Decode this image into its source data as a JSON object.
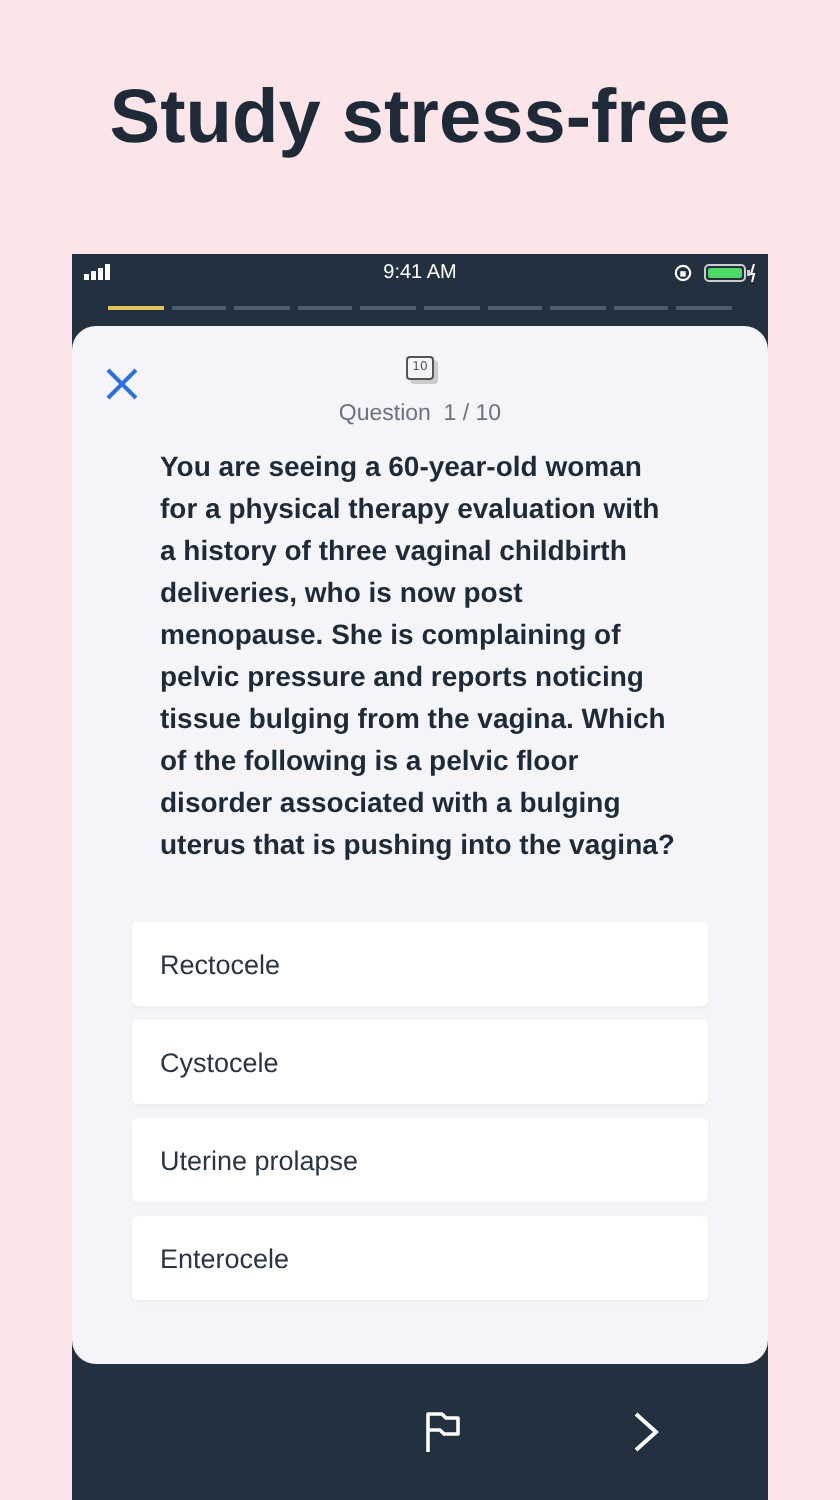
{
  "headline": "Study stress-free",
  "status_bar": {
    "time": "9:41 AM"
  },
  "progress_segments": [
    {
      "done": true
    },
    {
      "done": false
    },
    {
      "done": false
    },
    {
      "done": false
    },
    {
      "done": false
    },
    {
      "done": false
    },
    {
      "done": false
    },
    {
      "done": false
    },
    {
      "done": false
    },
    {
      "done": false
    }
  ],
  "question_icon": "10",
  "question_counter": "Question  1 / 10",
  "question_text": "You are seeing a 60-year-old woman for a physical therapy evaluation with a history of three vaginal childbirth deliveries, who is now post menopause. She is complaining of pelvic pressure and reports noticing tissue bulging from the vagina. Which of the following is a pelvic floor disorder associated with a bulging uterus that is pushing into the vagina?",
  "options": [
    {
      "label": "Rectocele",
      "selected": false
    },
    {
      "label": "Cystocele",
      "selected": false
    },
    {
      "label": "Uterine prolapse",
      "selected": false
    },
    {
      "label": "Enterocele",
      "selected": false
    }
  ]
}
